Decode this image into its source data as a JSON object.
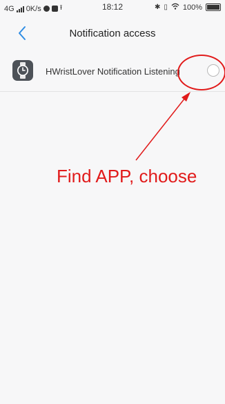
{
  "status": {
    "network": "4G",
    "speed": "0K/s",
    "time": "18:12",
    "battery": "100%"
  },
  "nav": {
    "title": "Notification access"
  },
  "app_item": {
    "label": "HWristLover Notification Listening",
    "enabled": false
  },
  "annotation": {
    "text": "Find APP, choose",
    "color": "#e11b1b"
  },
  "colors": {
    "accent": "#2f8de4"
  }
}
